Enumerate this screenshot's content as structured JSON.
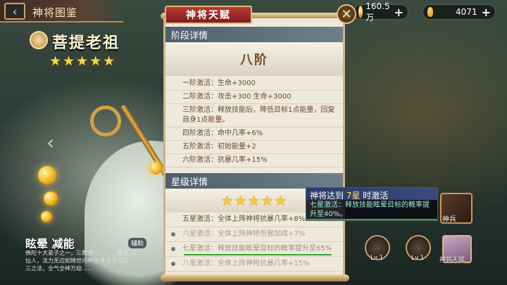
{
  "top": {
    "back_icon": "back-arrow-icon",
    "title": "神将图鉴",
    "coins": "160.5万",
    "gems": "4071",
    "close_icon": "close-x-icon"
  },
  "hero": {
    "name": "菩提老祖",
    "stars": "★★★★★",
    "skill_name": "眩晕 减能",
    "skill_desc": "佛陀十大弟子之一，三教合一，……\n重之仙人，法力无边如随世间神仙\n不生不灭三三之法，全气全神万劫……",
    "assist_label": "辅助"
  },
  "panel": {
    "tab_title": "神将天赋",
    "stage_section": "阶段详情",
    "rank_title": "八阶",
    "stages": [
      "一阶激活：生命+3000",
      "二阶激活：攻击+300 生命+3000",
      "三阶激活：释放技能后，降低目标1点能量，回复自身1点能量。",
      "四阶激活：命中几率+6%",
      "五阶激活：初始能量+2",
      "六阶激活：抗暴几率+15%"
    ],
    "star_section": "星级详情",
    "star_icons": "★★★★★",
    "star_levels": [
      "五星激活：全体上阵神将抗暴几率+8%",
      "六星激活：全体上阵神将伤害加成+7%",
      "七星激活：释放技能眩晕目标的概率提升至65%",
      "八星激活：全体上阵神将抗暴几率+15%"
    ]
  },
  "tooltip": {
    "title_prefix": "神将达到 ",
    "title_em": "7星",
    "title_suffix": " 时激活",
    "body": "七星激活：释放技能眩晕目标的概率提升至40%。"
  },
  "right": {
    "divine_weapon": "神兵",
    "lv1": "Lv.1",
    "lv2": "Lv.1",
    "talent": "神将天赋"
  }
}
